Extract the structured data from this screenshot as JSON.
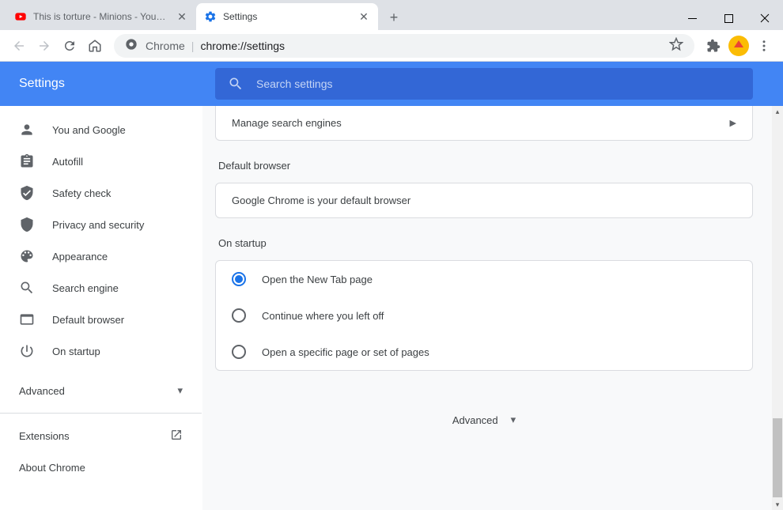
{
  "tabs": [
    {
      "title": "This is torture - Minions - YouTube"
    },
    {
      "title": "Settings"
    }
  ],
  "omnibox": {
    "prefix": "Chrome",
    "url": "chrome://settings"
  },
  "header": {
    "title": "Settings"
  },
  "search": {
    "placeholder": "Search settings"
  },
  "sidebar": {
    "items": [
      {
        "label": "You and Google",
        "icon": "person-icon"
      },
      {
        "label": "Autofill",
        "icon": "clipboard-icon"
      },
      {
        "label": "Safety check",
        "icon": "shield-check-icon"
      },
      {
        "label": "Privacy and security",
        "icon": "shield-icon"
      },
      {
        "label": "Appearance",
        "icon": "palette-icon"
      },
      {
        "label": "Search engine",
        "icon": "search-icon"
      },
      {
        "label": "Default browser",
        "icon": "browser-icon"
      },
      {
        "label": "On startup",
        "icon": "power-icon"
      }
    ],
    "advanced": "Advanced",
    "extensions": "Extensions",
    "about": "About Chrome"
  },
  "main": {
    "manage_search": "Manage search engines",
    "default_browser_title": "Default browser",
    "default_browser_text": "Google Chrome is your default browser",
    "on_startup_title": "On startup",
    "startup_options": [
      "Open the New Tab page",
      "Continue where you left off",
      "Open a specific page or set of pages"
    ],
    "advanced": "Advanced"
  }
}
